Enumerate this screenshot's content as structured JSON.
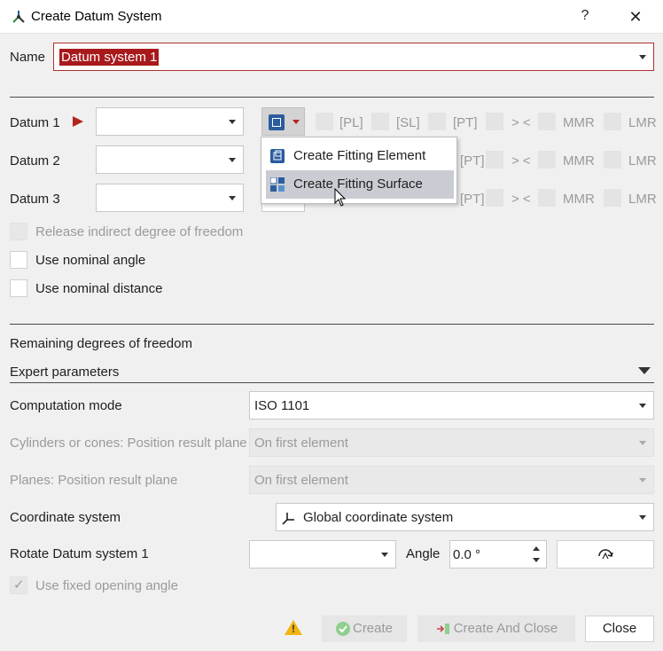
{
  "window": {
    "title": "Create Datum System",
    "help": "?",
    "close": "✕"
  },
  "name": {
    "label": "Name",
    "value": "Datum system 1"
  },
  "datums": [
    {
      "label": "Datum 1"
    },
    {
      "label": "Datum 2"
    },
    {
      "label": "Datum 3"
    }
  ],
  "datum_options": {
    "pl": "[PL]",
    "sl": "[SL]",
    "pt": "[PT]",
    "arrows": "> <",
    "mmr": "MMR",
    "lmr": "LMR"
  },
  "menu": {
    "items": [
      {
        "label": "Create Fitting Element",
        "icon": "fitting-element-icon"
      },
      {
        "label": "Create Fitting Surface",
        "icon": "fitting-surface-icon"
      }
    ]
  },
  "checks": {
    "release": "Release indirect degree of freedom",
    "nominal_angle": "Use nominal angle",
    "nominal_distance": "Use nominal distance"
  },
  "remaining_dof": "Remaining degrees of freedom",
  "expert": {
    "label": "Expert parameters",
    "computation_mode": {
      "label": "Computation mode",
      "value": "ISO 1101"
    },
    "cylinders": {
      "label": "Cylinders or cones: Position result plane",
      "value": "On first element"
    },
    "planes": {
      "label": "Planes: Position result plane",
      "value": "On first element"
    },
    "coordinate_system": {
      "label": "Coordinate system",
      "value": "Global coordinate system"
    },
    "rotate": {
      "label": "Rotate Datum system 1",
      "value": "",
      "angle_label": "Angle",
      "angle_value": "0.0 °"
    },
    "fixed_opening": "Use fixed opening angle"
  },
  "buttons": {
    "create": "Create",
    "create_close": "Create And Close",
    "close": "Close"
  },
  "colors": {
    "accent_red": "#b3241f",
    "selection": "#a8191c",
    "icon_blue": "#2b5c9e"
  }
}
